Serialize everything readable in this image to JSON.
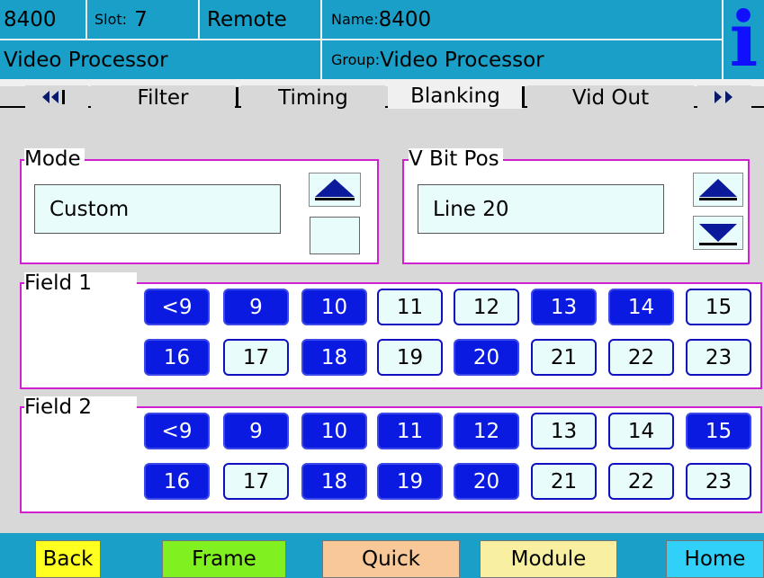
{
  "header": {
    "unit": "8400",
    "slot_label": "Slot:",
    "slot_value": "7",
    "mode": "Remote",
    "name_label": "Name:",
    "name_value": "8400",
    "device": "Video Processor",
    "group_label": "Group:",
    "group_value": "Video Processor",
    "info_glyph": "i"
  },
  "tabs": {
    "prev_icon": "double-left-arrow-icon",
    "next_icon": "double-right-arrow-icon",
    "items": [
      {
        "label": "Filter",
        "selected": false
      },
      {
        "label": "Timing",
        "selected": false
      },
      {
        "label": "Blanking",
        "selected": true
      },
      {
        "label": "Vid Out",
        "selected": false
      }
    ]
  },
  "mode": {
    "label": "Mode",
    "value": "Custom",
    "up_icon": "up-arrow-icon"
  },
  "vbit": {
    "label": "V Bit Pos",
    "value": "Line 20",
    "up_icon": "up-arrow-icon",
    "down_icon": "down-arrow-icon"
  },
  "field1": {
    "label": "Field 1",
    "rows": [
      [
        {
          "t": "<9",
          "on": true
        },
        {
          "t": "9",
          "on": true
        },
        {
          "t": "10",
          "on": true
        },
        {
          "t": "11",
          "on": false
        },
        {
          "t": "12",
          "on": false
        },
        {
          "t": "13",
          "on": true
        },
        {
          "t": "14",
          "on": true
        },
        {
          "t": "15",
          "on": false
        }
      ],
      [
        {
          "t": "16",
          "on": true
        },
        {
          "t": "17",
          "on": false
        },
        {
          "t": "18",
          "on": true
        },
        {
          "t": "19",
          "on": false
        },
        {
          "t": "20",
          "on": true
        },
        {
          "t": "21",
          "on": false
        },
        {
          "t": "22",
          "on": false
        },
        {
          "t": "23",
          "on": false
        }
      ]
    ]
  },
  "field2": {
    "label": "Field 2",
    "rows": [
      [
        {
          "t": "<9",
          "on": true
        },
        {
          "t": "9",
          "on": true
        },
        {
          "t": "10",
          "on": true
        },
        {
          "t": "11",
          "on": true
        },
        {
          "t": "12",
          "on": true
        },
        {
          "t": "13",
          "on": false
        },
        {
          "t": "14",
          "on": false
        },
        {
          "t": "15",
          "on": true
        }
      ],
      [
        {
          "t": "16",
          "on": true
        },
        {
          "t": "17",
          "on": false
        },
        {
          "t": "18",
          "on": true
        },
        {
          "t": "19",
          "on": true
        },
        {
          "t": "20",
          "on": true
        },
        {
          "t": "21",
          "on": false
        },
        {
          "t": "22",
          "on": false
        },
        {
          "t": "23",
          "on": false
        }
      ]
    ]
  },
  "bottom": {
    "buttons": [
      {
        "label": "Back",
        "color": "#ffff20"
      },
      {
        "label": "Frame",
        "color": "#80f020"
      },
      {
        "label": "Quick",
        "color": "#f8c898"
      },
      {
        "label": "Module",
        "color": "#f8f0a0"
      },
      {
        "label": "Home",
        "color": "#30d0f8"
      }
    ]
  },
  "colors": {
    "header_bg": "#1aa0c8",
    "selected_cell": "#0a1ae0",
    "unselected_cell": "#e8fcfc",
    "panel_border": "#d020d0"
  }
}
